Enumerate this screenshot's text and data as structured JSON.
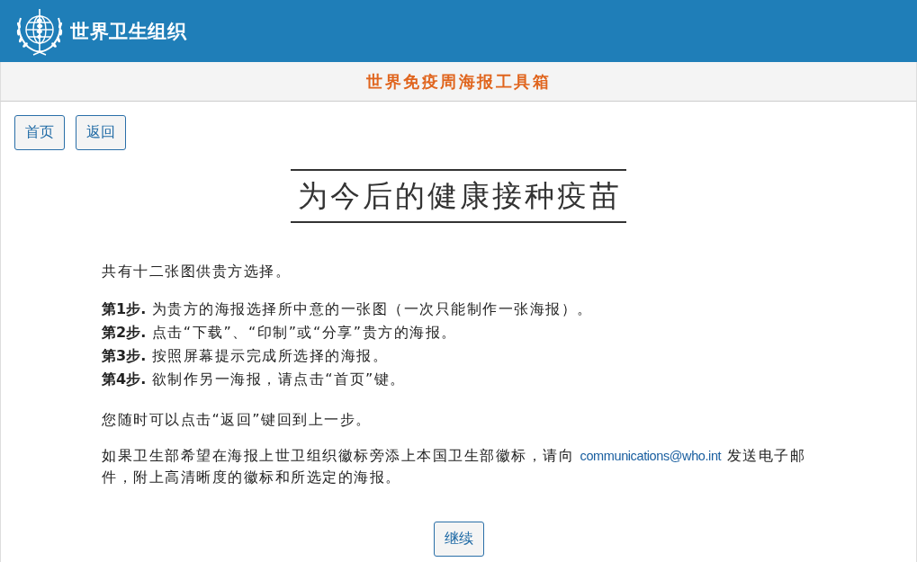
{
  "header": {
    "title": "世界卫生组织"
  },
  "toolbar": {
    "title": "世界免疫周海报工具箱"
  },
  "nav_buttons": [
    "首页",
    "返回"
  ],
  "poster_title": "为今后的健康接种疫苗",
  "intro": "共有十二张图供贵方选择。",
  "steps": [
    "**第1步.** 为贵方的海报选择所中意的一张图（一次只能制作一张海报）。",
    "**第2步.** 点击“下载”、“印制”或“分享”贵方的海报。",
    "**第3步.** 按照屏幕提示完成所选择的海报。",
    "**第4步.** 欲制作另一海报，请点击“首页”键。"
  ],
  "note": "您随时可以点击“返回”键回到上一步。",
  "contact": {
    "text_before": "如果卫生部希望在海报上世卫组织徽标旁添上本国卫生部徽标，请向",
    "link": "communications@who.int",
    "text_after": "发送电子邮件，附上高清晰度的徽标和所选定的海报。"
  },
  "continue_button": "继续"
}
